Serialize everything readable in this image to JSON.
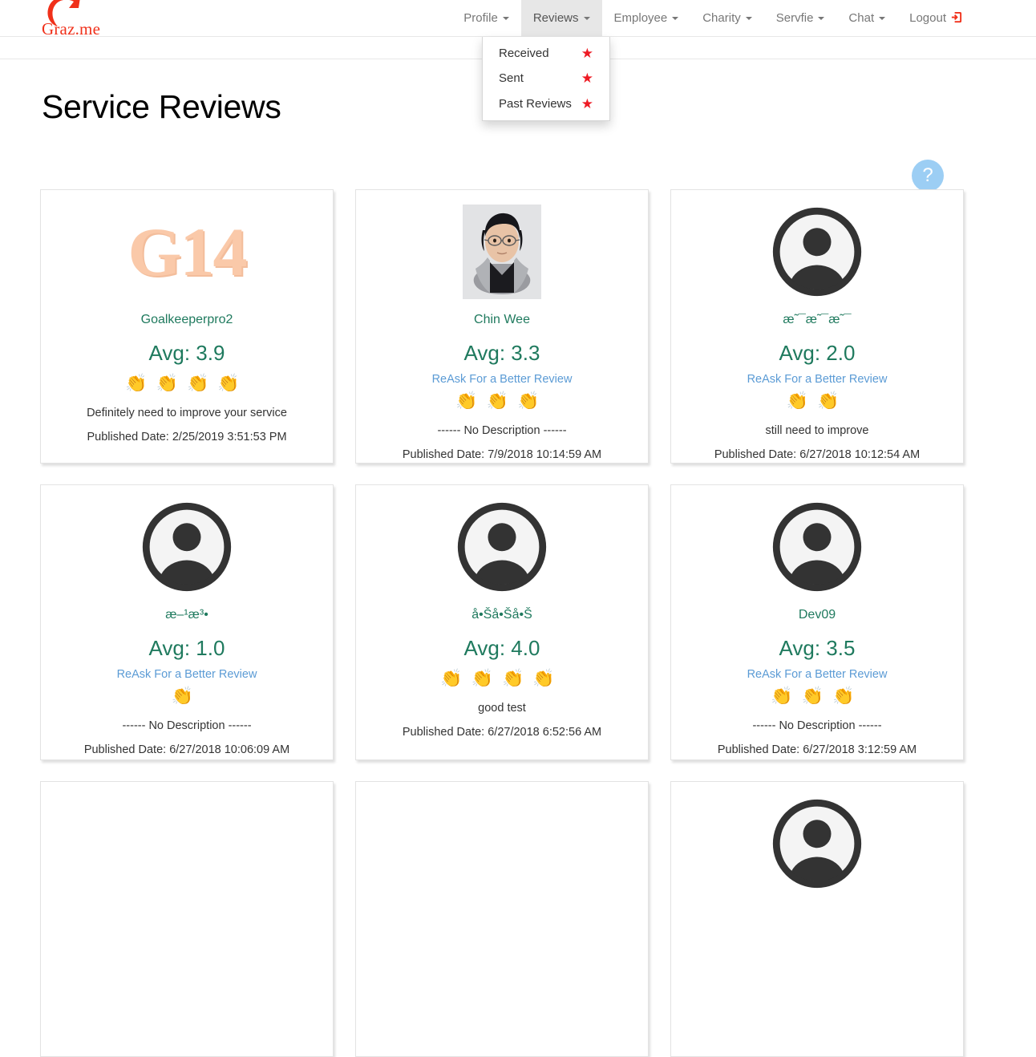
{
  "brand": {
    "name": "Graz.me",
    "logo_color": "#f0301a"
  },
  "nav": {
    "items": [
      {
        "label": "Profile",
        "has_caret": true,
        "active": false
      },
      {
        "label": "Reviews",
        "has_caret": true,
        "active": true
      },
      {
        "label": "Employee",
        "has_caret": true,
        "active": false
      },
      {
        "label": "Charity",
        "has_caret": true,
        "active": false
      },
      {
        "label": "Servfie",
        "has_caret": true,
        "active": false
      },
      {
        "label": "Chat",
        "has_caret": true,
        "active": false
      },
      {
        "label": "Logout",
        "has_caret": false,
        "active": false
      }
    ]
  },
  "dropdown": {
    "open_for": "Reviews",
    "items": [
      {
        "label": "Received",
        "icon": "star-icon"
      },
      {
        "label": "Sent",
        "icon": "star-icon"
      },
      {
        "label": "Past Reviews",
        "icon": "star-icon"
      }
    ],
    "star_color": "#ee1b24"
  },
  "page": {
    "title": "Service Reviews",
    "help_label": "?"
  },
  "cards": [
    {
      "avatar_type": "logo-text",
      "avatar_text": "G14",
      "name": "Goalkeeperpro2",
      "avg": "Avg: 3.9",
      "reask": null,
      "claps": 4,
      "description": "Definitely need to improve your service",
      "date": "Published Date: 2/25/2019 3:51:53 PM"
    },
    {
      "avatar_type": "photo",
      "avatar_text": "",
      "name": "Chin Wee",
      "avg": "Avg: 3.3",
      "reask": "ReAsk For a Better Review",
      "claps": 3,
      "description": "------ No Description ------",
      "date": "Published Date: 7/9/2018 10:14:59 AM"
    },
    {
      "avatar_type": "default",
      "avatar_text": "",
      "name": "æ˜¯æ˜¯æ˜¯",
      "avg": "Avg: 2.0",
      "reask": "ReAsk For a Better Review",
      "claps": 2,
      "description": "still need to improve",
      "date": "Published Date: 6/27/2018 10:12:54 AM"
    },
    {
      "avatar_type": "default",
      "avatar_text": "",
      "name": "æ–¹æ³•",
      "avg": "Avg: 1.0",
      "reask": "ReAsk For a Better Review",
      "claps": 1,
      "description": "------ No Description ------",
      "date": "Published Date: 6/27/2018 10:06:09 AM"
    },
    {
      "avatar_type": "default",
      "avatar_text": "",
      "name": "å•Šå•Šå•Š",
      "avg": "Avg: 4.0",
      "reask": null,
      "claps": 4,
      "description": "good test",
      "date": "Published Date: 6/27/2018 6:52:56 AM"
    },
    {
      "avatar_type": "default",
      "avatar_text": "",
      "name": "Dev09",
      "avg": "Avg: 3.5",
      "reask": "ReAsk For a Better Review",
      "claps": 3,
      "description": "------ No Description ------",
      "date": "Published Date: 6/27/2018 3:12:59 AM"
    },
    {
      "avatar_type": "logo-text",
      "avatar_text": "",
      "name": "",
      "avg": "",
      "reask": null,
      "claps": 0,
      "description": "",
      "date": ""
    },
    {
      "avatar_type": "blank",
      "avatar_text": "",
      "name": "",
      "avg": "",
      "reask": null,
      "claps": 0,
      "description": "",
      "date": ""
    },
    {
      "avatar_type": "default",
      "avatar_text": "",
      "name": "",
      "avg": "",
      "reask": null,
      "claps": 0,
      "description": "",
      "date": ""
    }
  ],
  "clap_glyph": "👏"
}
